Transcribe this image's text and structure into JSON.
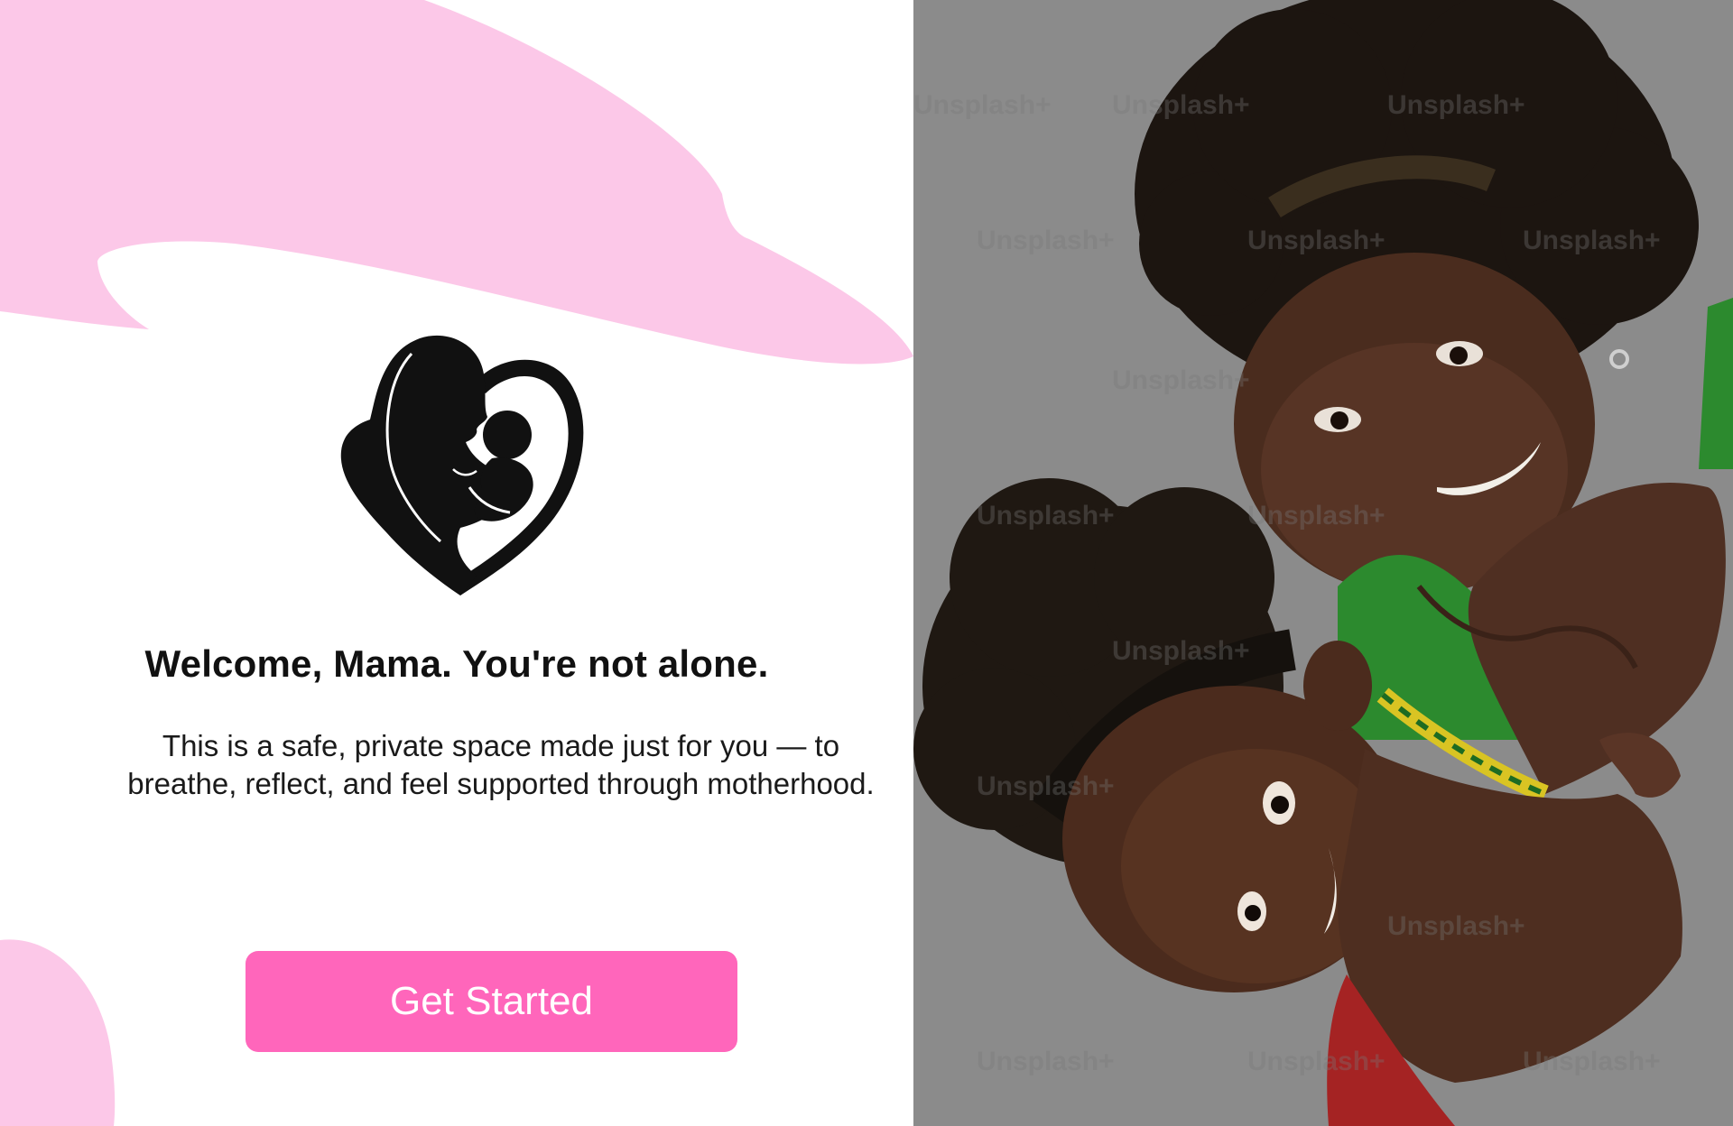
{
  "welcome": {
    "headline": "Welcome, Mama. You're not alone.",
    "description": "This is a safe, private space made just for you — to breathe, reflect, and feel supported through motherhood.",
    "cta_label": "Get Started"
  },
  "logo": {
    "icon": "mother-baby-heart-icon"
  },
  "hero_image": {
    "subject": "mother-and-child-photo",
    "watermark": "Unsplash+"
  },
  "colors": {
    "accent": "#ff66bb",
    "blob": "#fcc8e8",
    "text_dark": "#111111",
    "photo_background": "#8a8a8a",
    "button_text": "#ffffff"
  }
}
